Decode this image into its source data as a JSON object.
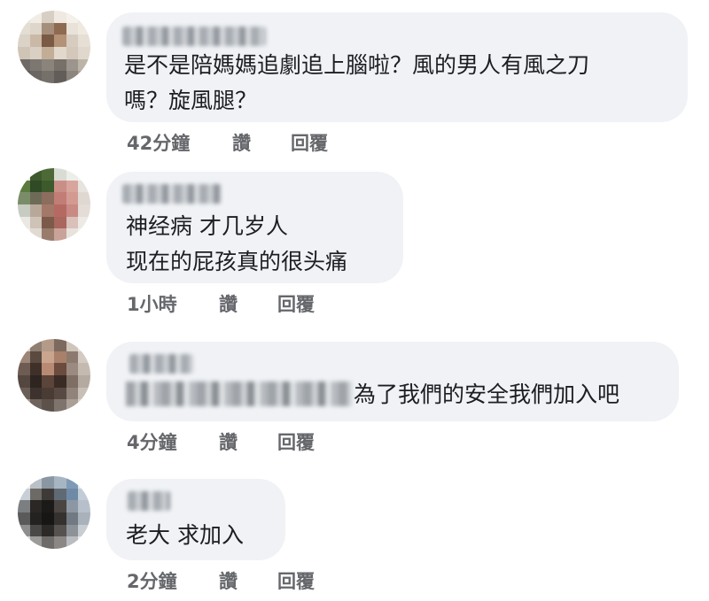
{
  "comments": [
    {
      "text": [
        "是不是陪媽媽追劇追上腦啦？風的男人有風之刀",
        "嗎？旋風腿？"
      ],
      "time": "42分鐘",
      "like": "讚",
      "reply": "回覆"
    },
    {
      "text": [
        "神经病  才几岁人",
        "现在的屁孩真的很头痛"
      ],
      "time": "1小時",
      "like": "讚",
      "reply": "回覆"
    },
    {
      "text": [
        "為了我們的安全我們加入吧"
      ],
      "time": "4分鐘",
      "like": "讚",
      "reply": "回覆"
    },
    {
      "text": [
        "老大 求加入"
      ],
      "time": "2分鐘",
      "like": "讚",
      "reply": "回覆"
    }
  ]
}
